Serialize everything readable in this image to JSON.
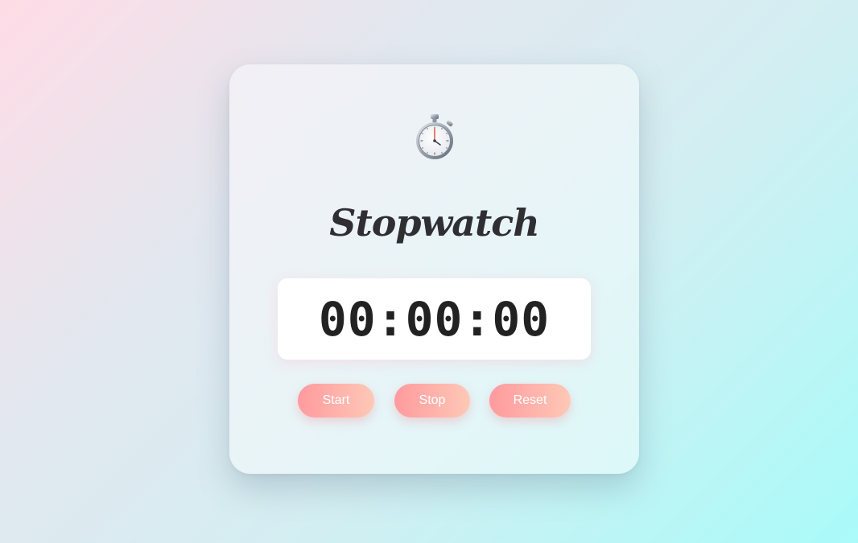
{
  "app": {
    "icon": "stopwatch-icon",
    "title": "Stopwatch"
  },
  "display": {
    "time": "00:00:00"
  },
  "controls": {
    "start_label": "Start",
    "stop_label": "Stop",
    "reset_label": "Reset"
  },
  "colors": {
    "button_gradient_start": "#ff9a9e",
    "button_gradient_end": "#fec8b6",
    "title_color": "#2f2f33",
    "time_color": "#222222",
    "display_bg": "#ffffff"
  }
}
